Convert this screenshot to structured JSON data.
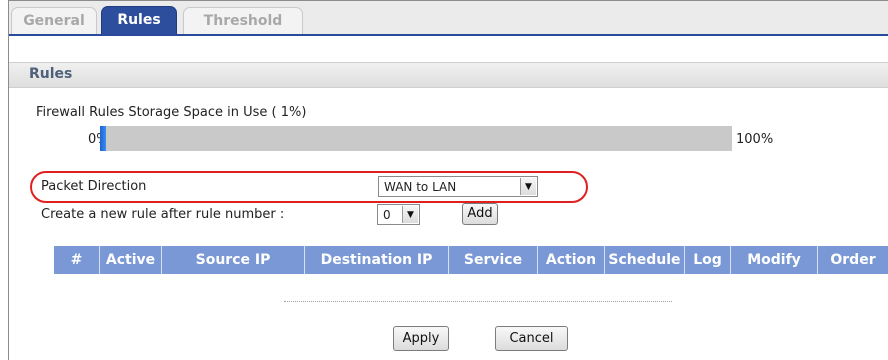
{
  "tabs": [
    {
      "label": "General",
      "active": false
    },
    {
      "label": "Rules",
      "active": true
    },
    {
      "label": "Threshold",
      "active": false
    }
  ],
  "section": {
    "title": "Rules"
  },
  "storage": {
    "label": "Firewall Rules Storage Space in Use  ( 1%)",
    "min_label": "0%",
    "max_label": "100%",
    "percent": 1
  },
  "packet_direction": {
    "label": "Packet Direction",
    "selected": "WAN to LAN"
  },
  "create_rule": {
    "label": "Create a new rule after rule number :",
    "selected": "0",
    "add_label": "Add"
  },
  "table": {
    "columns": [
      "#",
      "Active",
      "Source IP",
      "Destination IP",
      "Service",
      "Action",
      "Schedule",
      "Log",
      "Modify",
      "Order"
    ],
    "rows": []
  },
  "buttons": {
    "apply": "Apply",
    "cancel": "Cancel"
  },
  "colors": {
    "tab_active": "#2c4e9d",
    "header": "#7a98d6",
    "progress": "#1b64d2",
    "highlight": "#e02020"
  }
}
